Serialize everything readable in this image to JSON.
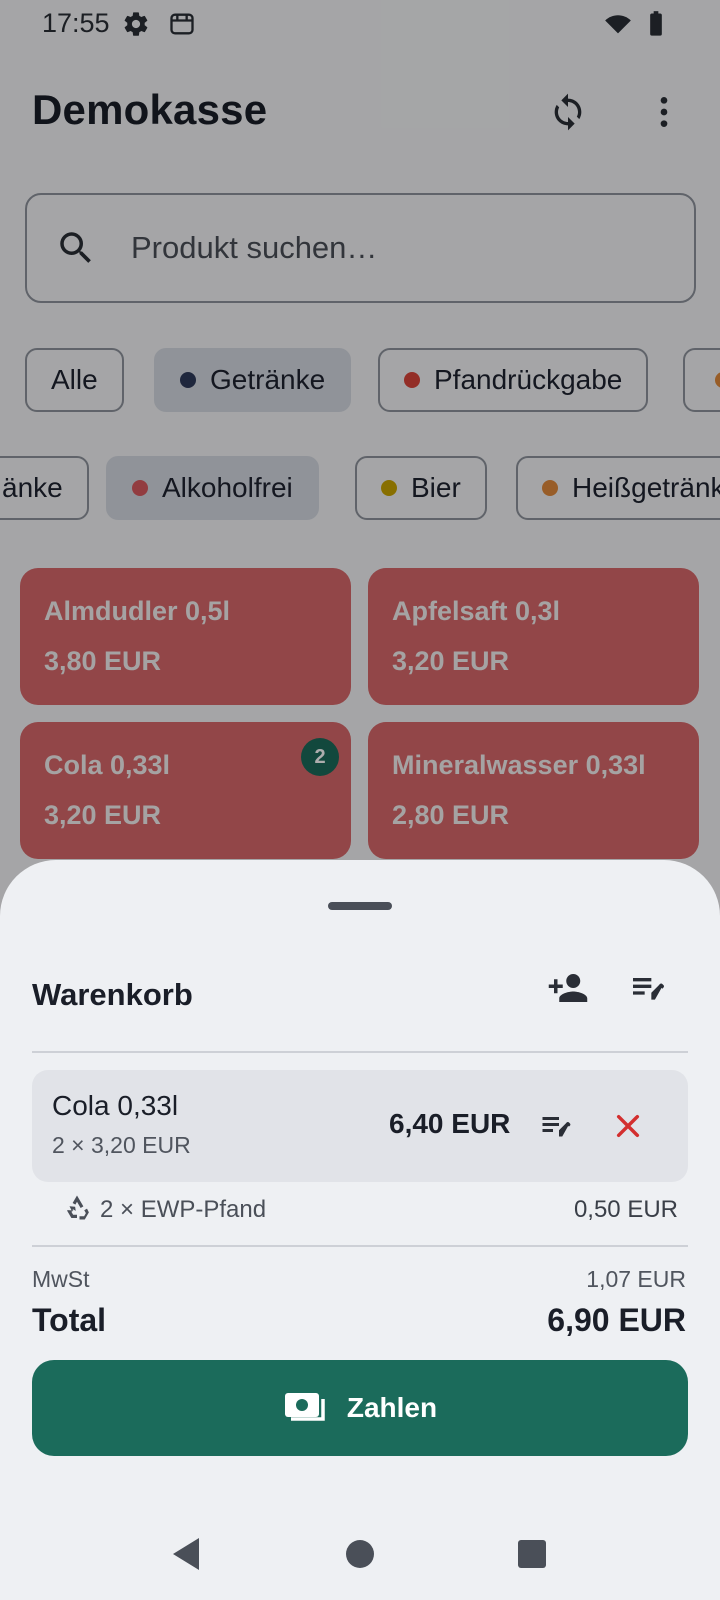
{
  "status_bar": {
    "time": "17:55",
    "icons": [
      "settings-icon",
      "store-icon",
      "wifi-icon",
      "battery-icon"
    ]
  },
  "app_bar": {
    "title": "Demokasse",
    "actions": [
      "sync-icon",
      "more-vert-icon"
    ]
  },
  "search": {
    "placeholder": "Produkt suchen…"
  },
  "categories": [
    {
      "label": "Alle",
      "selected": false,
      "dot_color": null
    },
    {
      "label": "Getränke",
      "selected": true,
      "dot_color": "#2f3a5a"
    },
    {
      "label": "Pfandrückgabe",
      "selected": false,
      "dot_color": "#d9443a"
    },
    {
      "label": "",
      "selected": false,
      "dot_color": "#e08a3c"
    }
  ],
  "subcategories": [
    {
      "label": "änke",
      "selected": false,
      "dot_color": null
    },
    {
      "label": "Alkoholfrei",
      "selected": true,
      "dot_color": "#d8595f"
    },
    {
      "label": "Bier",
      "selected": false,
      "dot_color": "#c9a400"
    },
    {
      "label": "Heißgetränk",
      "selected": false,
      "dot_color": "#e08a3c"
    }
  ],
  "products": [
    {
      "name": "Almdudler 0,5l",
      "price": "3,80 EUR",
      "badge": null
    },
    {
      "name": "Apfelsaft 0,3l",
      "price": "3,20 EUR",
      "badge": null
    },
    {
      "name": "Cola 0,33l",
      "price": "3,20 EUR",
      "badge": "2"
    },
    {
      "name": "Mineralwasser 0,33l",
      "price": "2,80 EUR",
      "badge": null
    }
  ],
  "cart": {
    "title": "Warenkorb",
    "actions": [
      "person-add-icon",
      "edit-note-icon"
    ],
    "items": [
      {
        "name": "Cola 0,33l",
        "quantity": "2 × 3,20 EUR",
        "total": "6,40 EUR"
      }
    ],
    "deposit": {
      "label": "2 × EWP-Pfand",
      "amount": "0,50 EUR"
    },
    "tax": {
      "label": "MwSt",
      "amount": "1,07 EUR"
    },
    "total": {
      "label": "Total",
      "amount": "6,90 EUR"
    },
    "pay_label": "Zahlen"
  },
  "colors": {
    "accent": "#1b6b5b",
    "product_tile": "#d8676a",
    "delete": "#d32f2f"
  }
}
